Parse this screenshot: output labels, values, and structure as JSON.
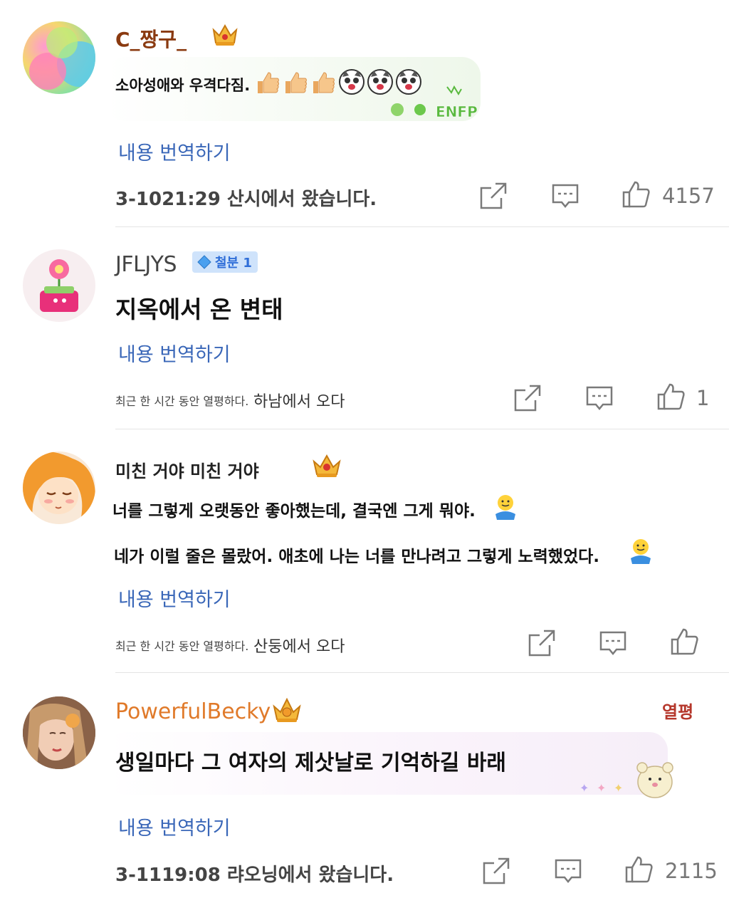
{
  "translate_label": "내용 번역하기",
  "comments": [
    {
      "username": "C_짱구_",
      "username_color": "#8a3a10",
      "text": "소아성애와 우격다짐.",
      "bubble_deco": "ENFP",
      "meta": "3-1021:29 산시에서 왔습니다.",
      "likes": "4157"
    },
    {
      "username": "JFLJYS",
      "username_color": "#444444",
      "rank_badge": "철분 1",
      "text": "지옥에서 온 변태",
      "meta_time": "최근 한 시간 동안 열평하다.",
      "meta_location": "하남에서 오다",
      "likes": "1"
    },
    {
      "username": "미친 거야 미친 거야",
      "username_color": "#222222",
      "text_line1": "너를 그렇게 오랫동안 좋아했는데, 결국엔 그게 뭐야.",
      "text_line2": "네가 이럴 줄은 몰랐어. 애초에 나는 너를 만나려고 그렇게 노력했었다.",
      "meta_time": "최근 한 시간 동안 열평하다.",
      "meta_location": "산둥에서 오다"
    },
    {
      "username": "PowerfulBecky",
      "username_color": "#e07a2a",
      "hot_badge": "열평",
      "text": "생일마다 그 여자의 제삿날로 기억하길 바래",
      "meta": "3-1119:08 랴오닝에서 왔습니다.",
      "likes": "2115"
    }
  ],
  "colors": {
    "link_blue": "#3a67b8",
    "hot_red": "#b5372b",
    "icon_gray": "#7a7a7a"
  },
  "icons": [
    "share-icon",
    "comment-icon",
    "thumbs-up-icon",
    "crown-badge-icon",
    "thumbs-up-emoji",
    "dog-face-emoji",
    "shrug-emoji"
  ]
}
